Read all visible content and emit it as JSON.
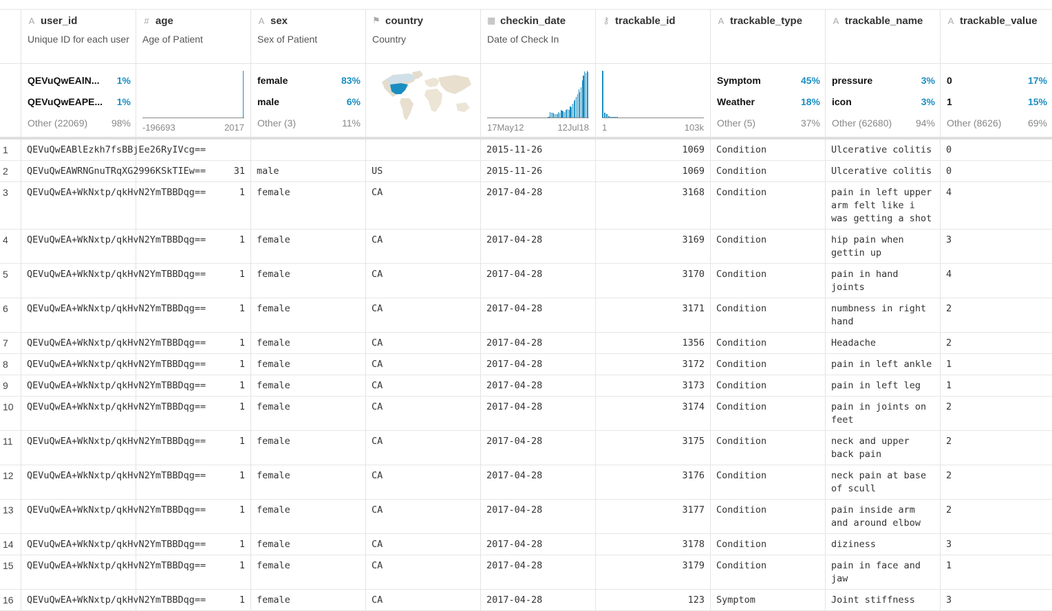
{
  "columns": [
    {
      "icon": "A",
      "icon_name": "text-type-icon",
      "name": "user_id",
      "desc": "Unique ID for each user"
    },
    {
      "icon": "#",
      "icon_name": "number-type-icon",
      "name": "age",
      "desc": "Age of Patient"
    },
    {
      "icon": "A",
      "icon_name": "text-type-icon",
      "name": "sex",
      "desc": "Sex of Patient"
    },
    {
      "icon": "⚑",
      "icon_name": "flag-icon",
      "name": "country",
      "desc": "Country"
    },
    {
      "icon": "▦",
      "icon_name": "calendar-icon",
      "name": "checkin_date",
      "desc": "Date of Check In"
    },
    {
      "icon": "⚷",
      "icon_name": "key-icon",
      "name": "trackable_id",
      "desc": ""
    },
    {
      "icon": "A",
      "icon_name": "text-type-icon",
      "name": "trackable_type",
      "desc": ""
    },
    {
      "icon": "A",
      "icon_name": "text-type-icon",
      "name": "trackable_name",
      "desc": ""
    },
    {
      "icon": "A",
      "icon_name": "text-type-icon",
      "name": "trackable_value",
      "desc": ""
    }
  ],
  "stats": {
    "user_id": [
      [
        "QEVuQwEAlN...",
        "1%"
      ],
      [
        "QEVuQwEAPE...",
        "1%"
      ],
      [
        "Other (22069)",
        "98%"
      ]
    ],
    "age": {
      "min": "-196693",
      "max": "2017"
    },
    "sex": [
      [
        "female",
        "83%"
      ],
      [
        "male",
        "6%"
      ],
      [
        "Other (3)",
        "11%"
      ]
    ],
    "checkin_date": {
      "min": "17May12",
      "max": "12Jul18"
    },
    "trackable_id": {
      "min": "1",
      "max": "103k"
    },
    "trackable_type": [
      [
        "Symptom",
        "45%"
      ],
      [
        "Weather",
        "18%"
      ],
      [
        "Other (5)",
        "37%"
      ]
    ],
    "trackable_name": [
      [
        "pressure",
        "3%"
      ],
      [
        "icon",
        "3%"
      ],
      [
        "Other (62680)",
        "94%"
      ]
    ],
    "trackable_value": [
      [
        "0",
        "17%"
      ],
      [
        "1",
        "15%"
      ],
      [
        "Other (8626)",
        "69%"
      ]
    ]
  },
  "histograms": {
    "age": [
      0,
      0,
      0,
      0,
      0,
      0,
      0,
      0,
      0,
      0,
      0,
      0,
      0,
      0,
      0,
      0,
      0,
      0,
      0,
      0,
      0,
      0,
      0,
      0,
      0,
      0,
      0,
      0,
      0,
      0,
      0,
      0,
      0,
      0,
      0,
      0,
      0,
      0,
      0,
      0,
      0,
      0,
      0,
      0,
      0,
      0,
      0,
      0,
      0,
      0,
      0,
      0,
      0,
      0,
      0,
      0,
      0,
      0,
      0,
      0,
      0,
      0,
      0,
      0,
      0,
      0,
      0,
      0,
      100
    ],
    "checkin_date": [
      0,
      0,
      0,
      0,
      0,
      0,
      0,
      0,
      0,
      0,
      0,
      0,
      0,
      0,
      0,
      0,
      0,
      0,
      0,
      0,
      0,
      0,
      0,
      0,
      0,
      0,
      0,
      0,
      0,
      0,
      0,
      0,
      0,
      0,
      0,
      0,
      0,
      0,
      0,
      0,
      0,
      0,
      0,
      0,
      0,
      0,
      0,
      0,
      0,
      0,
      0,
      2,
      2,
      12,
      11,
      10,
      9,
      8,
      8,
      8,
      12,
      10,
      16,
      15,
      13,
      12,
      16,
      18,
      17,
      16,
      24,
      22,
      30,
      35,
      38,
      44,
      50,
      60,
      55,
      65,
      80,
      90,
      98,
      95,
      100,
      97
    ],
    "trackable_id": [
      100,
      10,
      8,
      3,
      2,
      1,
      1,
      1,
      0,
      0,
      0,
      0,
      0,
      0,
      0,
      0,
      0,
      0,
      0,
      0,
      0,
      0,
      0,
      0,
      0,
      0,
      0,
      0,
      0,
      0,
      0,
      0,
      0,
      0,
      0,
      0,
      0,
      0,
      0,
      0,
      0,
      0,
      0,
      0,
      0,
      0,
      0,
      0,
      0,
      0
    ]
  },
  "rows": [
    {
      "n": "1",
      "user_id": "QEVuQwEABlEzkh7fsBBjEe26RyIVcg==",
      "age": "",
      "sex": "",
      "country": "",
      "date": "2015-11-26",
      "tid": "1069",
      "type": "Condition",
      "name": "Ulcerative colitis",
      "value": "0"
    },
    {
      "n": "2",
      "user_id": "QEVuQwEAWRNGnuTRqXG2996KSkTIEw==",
      "age": "31",
      "sex": "male",
      "country": "US",
      "date": "2015-11-26",
      "tid": "1069",
      "type": "Condition",
      "name": "Ulcerative colitis",
      "value": "0"
    },
    {
      "n": "3",
      "user_id": "QEVuQwEA+WkNxtp/qkHvN2YmTBBDqg==",
      "age": "1",
      "sex": "female",
      "country": "CA",
      "date": "2017-04-28",
      "tid": "3168",
      "type": "Condition",
      "name": "pain in left upper arm felt like i was getting a shot",
      "value": "4"
    },
    {
      "n": "4",
      "user_id": "QEVuQwEA+WkNxtp/qkHvN2YmTBBDqg==",
      "age": "1",
      "sex": "female",
      "country": "CA",
      "date": "2017-04-28",
      "tid": "3169",
      "type": "Condition",
      "name": "hip pain when gettin up",
      "value": "3"
    },
    {
      "n": "5",
      "user_id": "QEVuQwEA+WkNxtp/qkHvN2YmTBBDqg==",
      "age": "1",
      "sex": "female",
      "country": "CA",
      "date": "2017-04-28",
      "tid": "3170",
      "type": "Condition",
      "name": "pain in hand joints",
      "value": "4"
    },
    {
      "n": "6",
      "user_id": "QEVuQwEA+WkNxtp/qkHvN2YmTBBDqg==",
      "age": "1",
      "sex": "female",
      "country": "CA",
      "date": "2017-04-28",
      "tid": "3171",
      "type": "Condition",
      "name": "numbness in right hand",
      "value": "2"
    },
    {
      "n": "7",
      "user_id": "QEVuQwEA+WkNxtp/qkHvN2YmTBBDqg==",
      "age": "1",
      "sex": "female",
      "country": "CA",
      "date": "2017-04-28",
      "tid": "1356",
      "type": "Condition",
      "name": "Headache",
      "value": "2"
    },
    {
      "n": "8",
      "user_id": "QEVuQwEA+WkNxtp/qkHvN2YmTBBDqg==",
      "age": "1",
      "sex": "female",
      "country": "CA",
      "date": "2017-04-28",
      "tid": "3172",
      "type": "Condition",
      "name": "pain in left ankle",
      "value": "1"
    },
    {
      "n": "9",
      "user_id": "QEVuQwEA+WkNxtp/qkHvN2YmTBBDqg==",
      "age": "1",
      "sex": "female",
      "country": "CA",
      "date": "2017-04-28",
      "tid": "3173",
      "type": "Condition",
      "name": "pain in left leg",
      "value": "1"
    },
    {
      "n": "10",
      "user_id": "QEVuQwEA+WkNxtp/qkHvN2YmTBBDqg==",
      "age": "1",
      "sex": "female",
      "country": "CA",
      "date": "2017-04-28",
      "tid": "3174",
      "type": "Condition",
      "name": "pain in joints on feet",
      "value": "2"
    },
    {
      "n": "11",
      "user_id": "QEVuQwEA+WkNxtp/qkHvN2YmTBBDqg==",
      "age": "1",
      "sex": "female",
      "country": "CA",
      "date": "2017-04-28",
      "tid": "3175",
      "type": "Condition",
      "name": "neck and upper back pain",
      "value": "2"
    },
    {
      "n": "12",
      "user_id": "QEVuQwEA+WkNxtp/qkHvN2YmTBBDqg==",
      "age": "1",
      "sex": "female",
      "country": "CA",
      "date": "2017-04-28",
      "tid": "3176",
      "type": "Condition",
      "name": "neck pain at base of scull",
      "value": "2"
    },
    {
      "n": "13",
      "user_id": "QEVuQwEA+WkNxtp/qkHvN2YmTBBDqg==",
      "age": "1",
      "sex": "female",
      "country": "CA",
      "date": "2017-04-28",
      "tid": "3177",
      "type": "Condition",
      "name": "pain inside arm and around elbow",
      "value": "2"
    },
    {
      "n": "14",
      "user_id": "QEVuQwEA+WkNxtp/qkHvN2YmTBBDqg==",
      "age": "1",
      "sex": "female",
      "country": "CA",
      "date": "2017-04-28",
      "tid": "3178",
      "type": "Condition",
      "name": "diziness",
      "value": "3"
    },
    {
      "n": "15",
      "user_id": "QEVuQwEA+WkNxtp/qkHvN2YmTBBDqg==",
      "age": "1",
      "sex": "female",
      "country": "CA",
      "date": "2017-04-28",
      "tid": "3179",
      "type": "Condition",
      "name": "pain in face and jaw",
      "value": "1"
    },
    {
      "n": "16",
      "user_id": "QEVuQwEA+WkNxtp/qkHvN2YmTBBDqg==",
      "age": "1",
      "sex": "female",
      "country": "CA",
      "date": "2017-04-28",
      "tid": "123",
      "type": "Symptom",
      "name": "Joint stiffness",
      "value": "3"
    }
  ],
  "colors": {
    "accent": "#1a8ec2",
    "map_land": "#e8dfcf",
    "map_highlight": "#1a8ec2"
  }
}
